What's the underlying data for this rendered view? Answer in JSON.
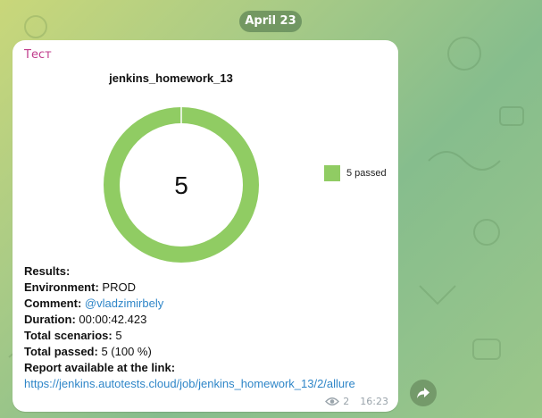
{
  "chat": {
    "date_label": "April 23"
  },
  "message": {
    "sender": "Тест",
    "views": "2",
    "time": "16:23",
    "lines": {
      "results_label": "Results:",
      "env_label": "Environment:",
      "env_value": " PROD",
      "comment_label": "Comment:",
      "comment_value": " @vladzimirbely",
      "duration_label": "Duration:",
      "duration_value": " 00:00:42.423",
      "scenarios_label": "Total scenarios:",
      "scenarios_value": " 5",
      "passed_label": "Total passed:",
      "passed_value": " 5 (100 %)",
      "report_label": "Report available at the link:",
      "report_url": "https://jenkins.autotests.cloud/job/jenkins_homework_13/2/allure"
    }
  },
  "chart_data": {
    "type": "pie",
    "title": "jenkins_homework_13",
    "center_label": "5",
    "legend_position": "right",
    "slices": [
      {
        "label": "5 passed",
        "value": 5,
        "color": "#90cc63"
      }
    ]
  },
  "icons": {
    "views": "eye-icon",
    "forward": "share-arrow-icon"
  }
}
